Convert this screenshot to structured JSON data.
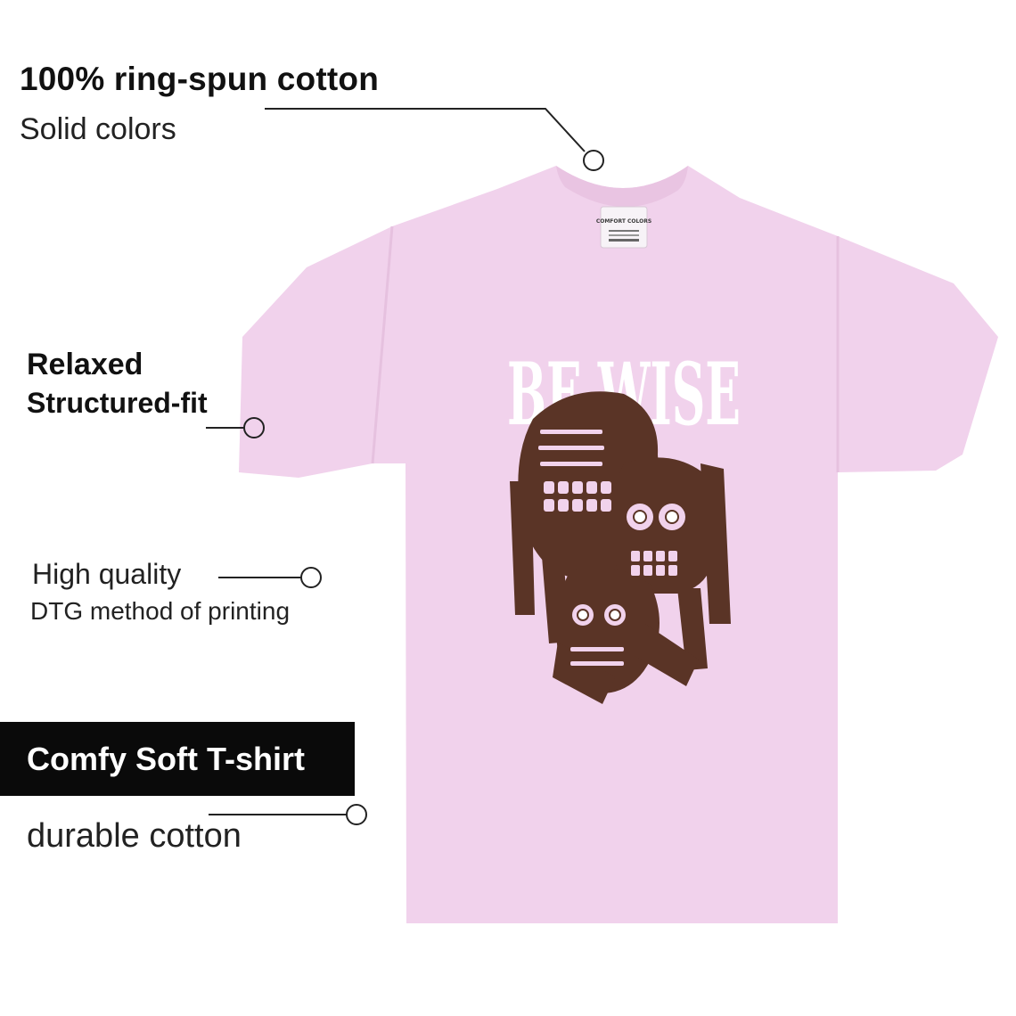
{
  "features": {
    "material_title": "100% ring-spun cotton",
    "material_sub": "Solid colors",
    "fit_line_1": "Relaxed",
    "fit_line_2": "Structured-fit",
    "print_title": "High quality",
    "print_sub": "DTG method of printing",
    "badge_label": "Comfy Soft T-shirt",
    "durability": "durable cotton"
  },
  "product": {
    "graphic_text": "BE WISE",
    "neck_label_brand": "COMFORT COLORS",
    "shirt_color": "#f1d2ec",
    "graphic_color": "#5a3426"
  },
  "colors": {
    "text": "#111111",
    "badge_bg": "#0a0a0a",
    "badge_text": "#ffffff",
    "callout_line": "#222222"
  }
}
